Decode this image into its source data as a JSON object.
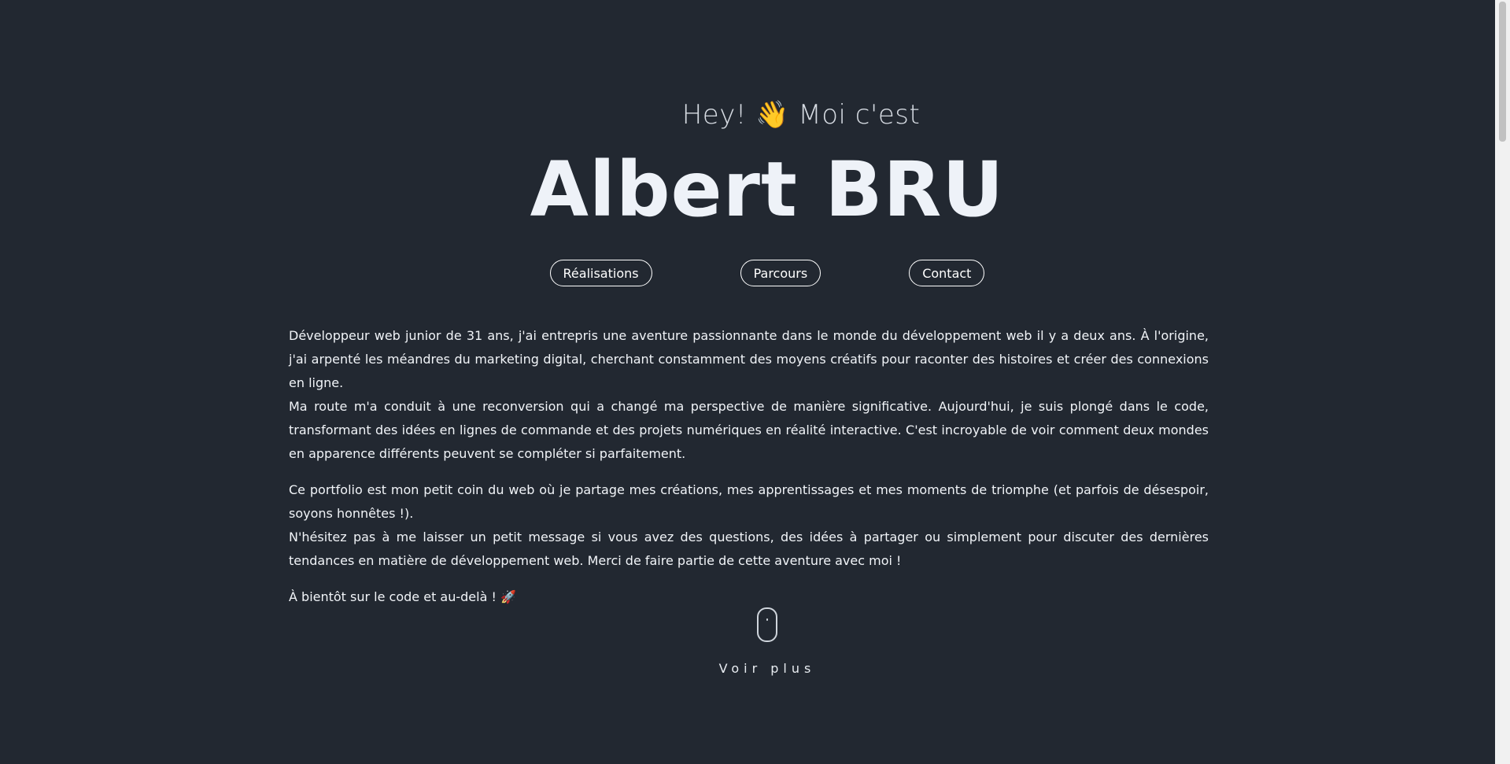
{
  "hero": {
    "greeting": "Hey! 👋 Moi c'est",
    "name": "Albert BRU"
  },
  "nav": {
    "items": [
      {
        "label": "Réalisations"
      },
      {
        "label": "Parcours"
      },
      {
        "label": "Contact"
      }
    ]
  },
  "bio": {
    "p1_line1": "Développeur web junior de 31 ans, j'ai entrepris une aventure passionnante dans le monde du développement web il y a deux ans. À l'origine, j'ai arpenté les méandres du marketing digital, cherchant constamment des moyens créatifs pour raconter des histoires et créer des connexions en ligne.",
    "p1_line2": "Ma route m'a conduit à une reconversion qui a changé ma perspective de manière significative. Aujourd'hui, je suis plongé dans le code, transformant des idées en lignes de commande et des projets numériques en réalité interactive. C'est incroyable de voir comment deux mondes en apparence différents peuvent se compléter si parfaitement.",
    "p2_line1": "Ce portfolio est mon petit coin du web où je partage mes créations, mes apprentissages et mes moments de triomphe (et parfois de désespoir, soyons honnêtes !).",
    "p2_line2": "N'hésitez pas à me laisser un petit message si vous avez des questions, des idées à partager ou simplement pour discuter des dernières tendances en matière de développement web. Merci de faire partie de cette aventure avec moi !",
    "p3": "À bientôt sur le code et au-delà ! 🚀"
  },
  "scroll_hint": {
    "label": "Voir plus"
  }
}
